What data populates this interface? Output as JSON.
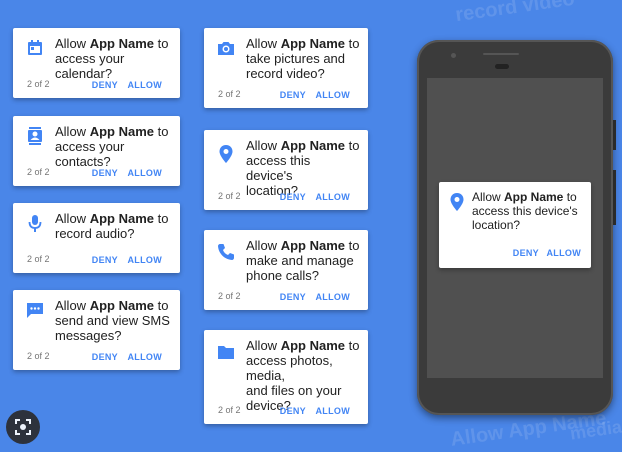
{
  "app_name": "App Name",
  "allow_prefix": "Allow ",
  "colors": {
    "accent": "#4285f4",
    "background": "#4a86e8"
  },
  "cards": [
    {
      "icon": "calendar-icon",
      "suffix_1": " to",
      "line_2": "access your calendar?",
      "line_3": "",
      "line_4": "",
      "counter": "2 of 2",
      "deny": "DENY",
      "allow": "ALLOW"
    },
    {
      "icon": "contacts-icon",
      "suffix_1": " to",
      "line_2": "access your contacts?",
      "line_3": "",
      "line_4": "",
      "counter": "2 of 2",
      "deny": "DENY",
      "allow": "ALLOW"
    },
    {
      "icon": "microphone-icon",
      "suffix_1": " to",
      "line_2": "record audio?",
      "line_3": "",
      "line_4": "",
      "counter": "2 of 2",
      "deny": "DENY",
      "allow": "ALLOW"
    },
    {
      "icon": "sms-icon",
      "suffix_1": " to",
      "line_2": "send and view SMS",
      "line_3": "messages?",
      "line_4": "",
      "counter": "2 of 2",
      "deny": "DENY",
      "allow": "ALLOW"
    },
    {
      "icon": "camera-icon",
      "suffix_1": " to",
      "line_2": "take pictures and",
      "line_3": "record video?",
      "line_4": "",
      "counter": "2 of 2",
      "deny": "DENY",
      "allow": "ALLOW"
    },
    {
      "icon": "location-icon",
      "suffix_1": " to",
      "line_2": "access this device's",
      "line_3": "location?",
      "line_4": "",
      "counter": "2 of 2",
      "deny": "DENY",
      "allow": "ALLOW"
    },
    {
      "icon": "phone-icon",
      "suffix_1": " to",
      "line_2": "make and manage",
      "line_3": "phone calls?",
      "line_4": "",
      "counter": "2 of 2",
      "deny": "DENY",
      "allow": "ALLOW"
    },
    {
      "icon": "folder-icon",
      "suffix_1": " to",
      "line_2": "access photos, media,",
      "line_3": "and files on your",
      "line_4": "device?",
      "counter": "2 of 2",
      "deny": "DENY",
      "allow": "ALLOW"
    }
  ],
  "phone_dialog": {
    "icon": "location-icon",
    "suffix_1": " to",
    "line_2": "access this device's",
    "line_3": "location?",
    "deny": "DENY",
    "allow": "ALLOW"
  },
  "background_text": {
    "top": "record video",
    "bottom": "Allow App Name",
    "bottom_2": "media"
  }
}
